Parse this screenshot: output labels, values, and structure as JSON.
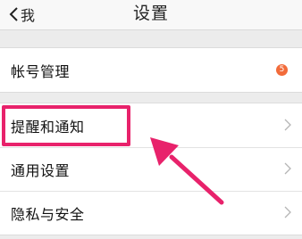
{
  "nav": {
    "back_label": "我",
    "title": "设置"
  },
  "groups": [
    {
      "items": [
        {
          "label": "帐号管理",
          "badge": "5"
        }
      ]
    },
    {
      "items": [
        {
          "label": "提醒和通知"
        },
        {
          "label": "通用设置"
        },
        {
          "label": "隐私与安全"
        }
      ]
    }
  ],
  "colors": {
    "annotation": "#e8226b",
    "badge": "#f26b3a"
  }
}
